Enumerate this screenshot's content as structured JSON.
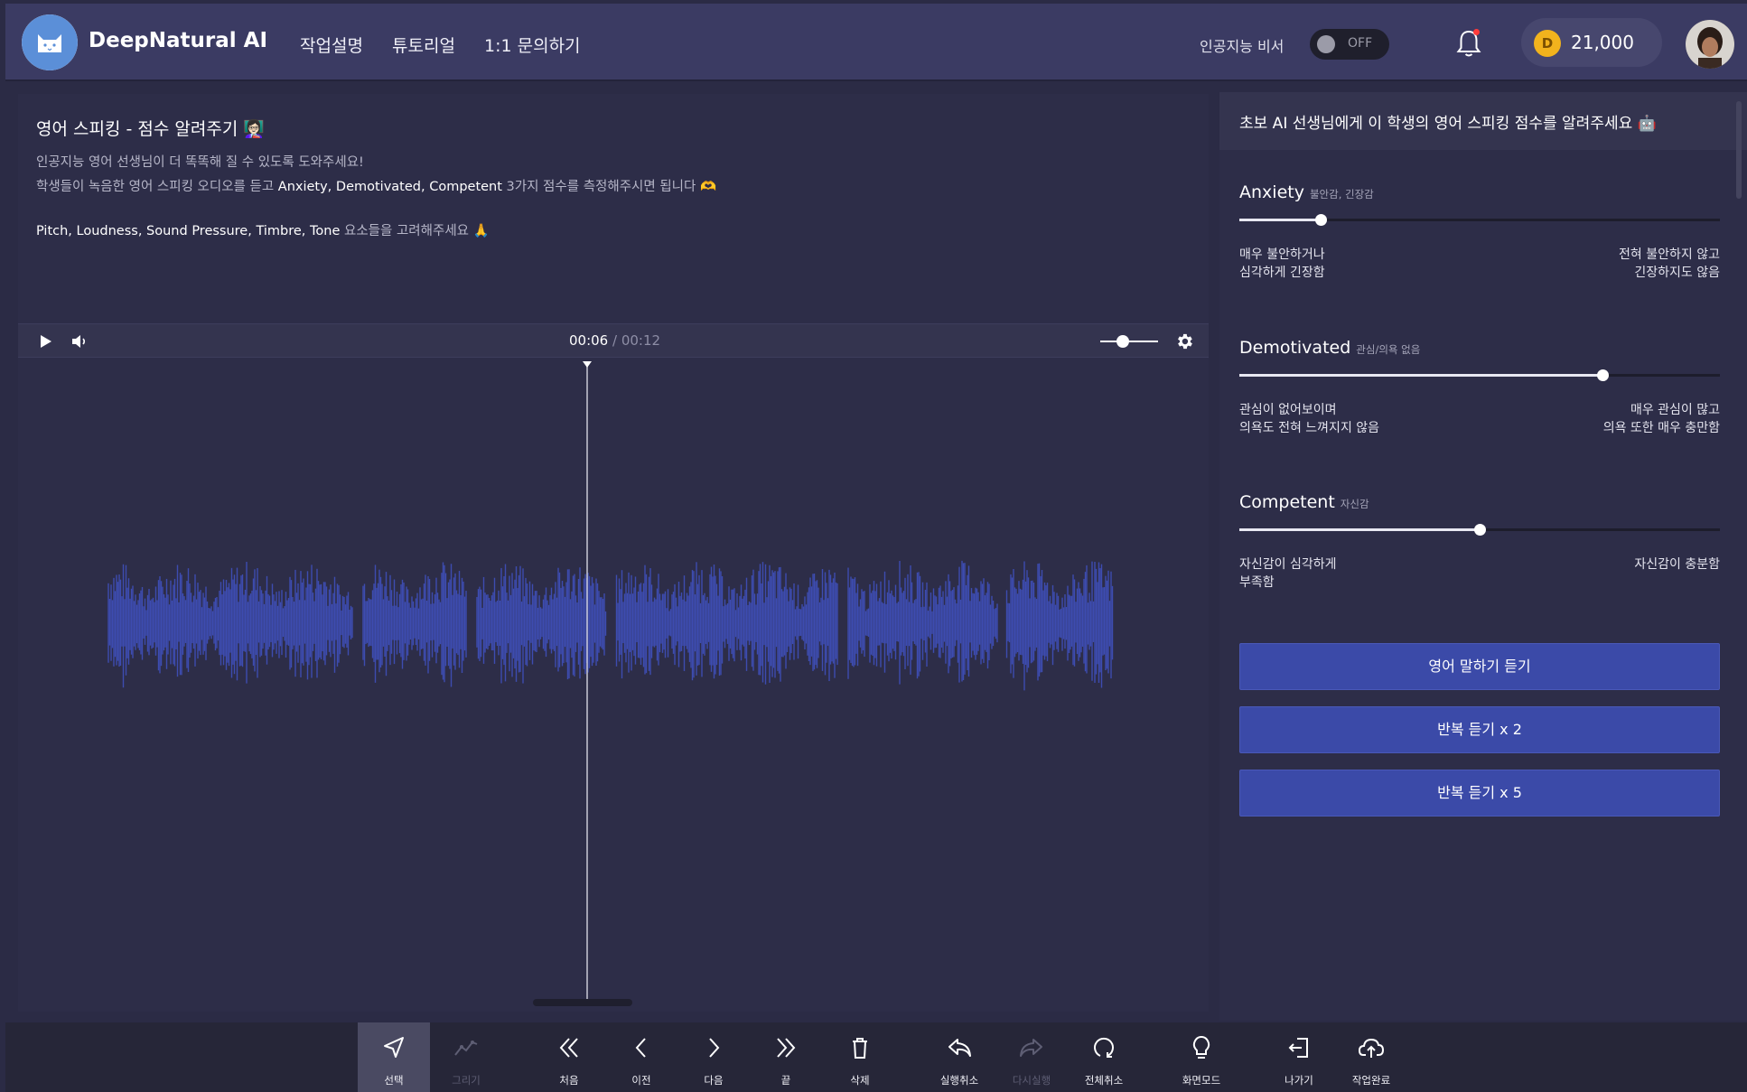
{
  "app": {
    "name": "DeepNatural AI",
    "logo_icon": "cat-logo-icon",
    "colors": {
      "header": "#3b3b63",
      "panel": "#2d2d48",
      "accent": "#3b4aa8",
      "waveform": "#3d4cb0",
      "coin": "#f2b31d"
    }
  },
  "nav": {
    "items": [
      {
        "label": "작업설명"
      },
      {
        "label": "튜토리얼"
      },
      {
        "label": "1:1 문의하기"
      }
    ]
  },
  "header": {
    "ai_assistant_label": "인공지능 비서",
    "toggle_state": "OFF",
    "notification_icon": "bell-icon",
    "coin_icon_letter": "D",
    "coin_balance": "21,000",
    "avatar_icon": "user-avatar"
  },
  "task": {
    "title": "영어 스피킹 - 점수 알려주기 👩🏻‍🏫",
    "line1": "인공지능 영어 선생님이 더 똑똑해 질 수 있도록 도와주세요!",
    "line2_pre": "학생들이 녹음한 영어 스피킹 오디오를 듣고 ",
    "line2_terms": "Anxiety, Demotivated, Competent",
    "line2_post": " 3가지 점수를 측정해주시면 됩니다 🫶",
    "line3_terms": "Pitch, Loudness, Sound Pressure, Timbre, Tone",
    "line3_post": " 요소들을 고려해주세요 🙏"
  },
  "player": {
    "current_time": "00:06",
    "separator": " / ",
    "duration": "00:12",
    "progress": 0.5,
    "volume": 0.3
  },
  "rating_panel": {
    "title": "초보 AI 선생님에게 이 학생의 영어 스피킹 점수를 알려주세요 🤖",
    "metrics": [
      {
        "name": "Anxiety",
        "sub": "불안감, 긴장감",
        "value": 0.17,
        "left_label_1": "매우 불안하거나",
        "left_label_2": "심각하게 긴장함",
        "right_label_1": "전혀 불안하지 않고",
        "right_label_2": "긴장하지도 않음"
      },
      {
        "name": "Demotivated",
        "sub": "관심/의욕 없음",
        "value": 0.755,
        "left_label_1": "관심이 없어보이며",
        "left_label_2": "의욕도 전혀 느껴지지 않음",
        "right_label_1": "매우 관심이 많고",
        "right_label_2": "의욕 또한 매우 충만함"
      },
      {
        "name": "Competent",
        "sub": "자신감",
        "value": 0.5,
        "left_label_1": "자신감이 심각하게",
        "left_label_2": "부족함",
        "right_label_1": "자신감이 충분함",
        "right_label_2": ""
      }
    ],
    "buttons": [
      {
        "label": "영어 말하기 듣기"
      },
      {
        "label": "반복 듣기 x 2"
      },
      {
        "label": "반복 듣기 x 5"
      }
    ]
  },
  "toolbar": {
    "tools": [
      {
        "label": "선택",
        "icon": "cursor-arrow-icon",
        "active": true,
        "disabled": false
      },
      {
        "label": "그리기",
        "icon": "draw-line-icon",
        "active": false,
        "disabled": true
      },
      {
        "label": "처음",
        "icon": "double-chevron-left-icon",
        "active": false,
        "disabled": false
      },
      {
        "label": "이전",
        "icon": "chevron-left-icon",
        "active": false,
        "disabled": false
      },
      {
        "label": "다음",
        "icon": "chevron-right-icon",
        "active": false,
        "disabled": false
      },
      {
        "label": "끝",
        "icon": "double-chevron-right-icon",
        "active": false,
        "disabled": false
      },
      {
        "label": "삭제",
        "icon": "trash-icon",
        "active": false,
        "disabled": false
      },
      {
        "label": "실행취소",
        "icon": "undo-icon",
        "active": false,
        "disabled": false
      },
      {
        "label": "다시실행",
        "icon": "redo-icon",
        "active": false,
        "disabled": true
      },
      {
        "label": "전체취소",
        "icon": "reset-icon",
        "active": false,
        "disabled": false
      },
      {
        "label": "화면모드",
        "icon": "lightbulb-icon",
        "active": false,
        "disabled": false
      },
      {
        "label": "나가기",
        "icon": "exit-icon",
        "active": false,
        "disabled": false
      },
      {
        "label": "작업완료",
        "icon": "cloud-upload-icon",
        "active": false,
        "disabled": false
      }
    ]
  }
}
